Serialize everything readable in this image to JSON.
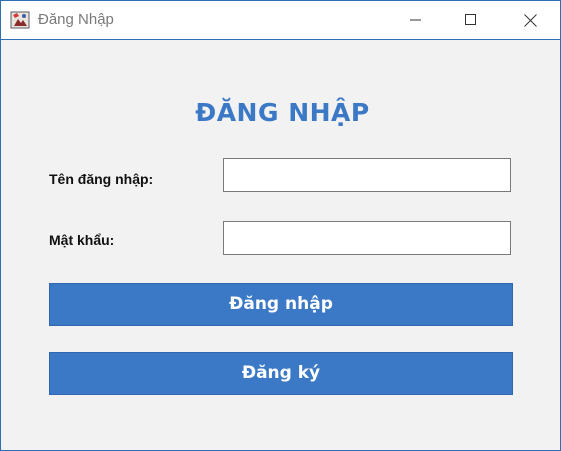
{
  "window": {
    "title": "Đăng Nhập",
    "icon": "java-app-icon",
    "controls": [
      "minimize-icon",
      "maximize-icon",
      "close-icon"
    ]
  },
  "form": {
    "heading": "ĐĂNG NHẬP",
    "username_label": "Tên đăng nhập:",
    "username_value": "",
    "password_label": "Mật khẩu:",
    "password_value": "",
    "login_button": "Đăng nhập",
    "register_button": "Đăng ký"
  },
  "colors": {
    "accent": "#3b78c6",
    "background": "#f2f2f2",
    "window_border": "#2f6db5"
  }
}
